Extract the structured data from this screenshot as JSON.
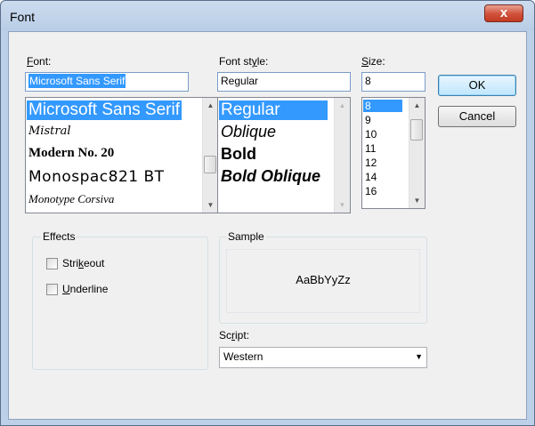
{
  "window": {
    "title": "Font",
    "close_glyph": "x"
  },
  "font": {
    "label_underlined": "F",
    "label_rest": "ont:",
    "value": "Microsoft Sans Serif",
    "items": [
      "Microsoft Sans Serif",
      "Mistral",
      "Modern No. 20",
      "Monospac821 BT",
      "Monotype Corsiva"
    ]
  },
  "style": {
    "label_pre": "Font st",
    "label_underlined": "y",
    "label_post": "le:",
    "value": "Regular",
    "items": [
      "Regular",
      "Oblique",
      "Bold",
      "Bold Oblique"
    ]
  },
  "size": {
    "label_underlined": "S",
    "label_rest": "ize:",
    "value": "8",
    "items": [
      "8",
      "9",
      "10",
      "11",
      "12",
      "14",
      "16"
    ]
  },
  "buttons": {
    "ok": "OK",
    "cancel": "Cancel"
  },
  "effects": {
    "title": "Effects",
    "strikeout_pre": "Stri",
    "strikeout_underlined": "k",
    "strikeout_post": "eout",
    "underline_underlined": "U",
    "underline_post": "nderline",
    "strikeout_checked": false,
    "underline_checked": false
  },
  "sample": {
    "title": "Sample",
    "text": "AaBbYyZz"
  },
  "script": {
    "label_pre": "Sc",
    "label_underlined": "r",
    "label_post": "ipt:",
    "value": "Western"
  },
  "icons": {
    "scroll_up": "▲",
    "scroll_down": "▼",
    "dropdown": "▼"
  },
  "colors": {
    "selection": "#3399ff",
    "title_bar": "#bcd0e8",
    "close_button": "#c9402b"
  }
}
